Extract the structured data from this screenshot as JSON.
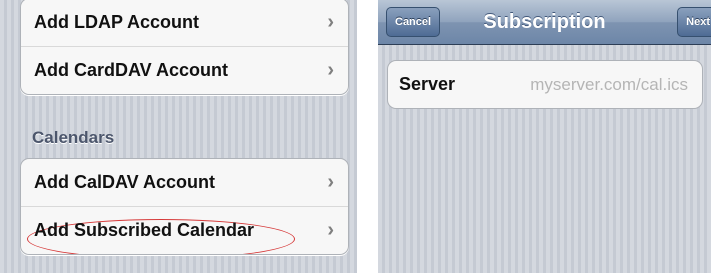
{
  "left_screen": {
    "top_group": [
      {
        "label": "Add LDAP Account"
      },
      {
        "label": "Add CardDAV Account"
      }
    ],
    "section_header": "Calendars",
    "calendar_group": [
      {
        "label": "Add CalDAV Account"
      },
      {
        "label": "Add Subscribed Calendar"
      }
    ],
    "disclosure_icon": "chevron-right-icon",
    "annotation_color": "#d63a3a"
  },
  "right_screen": {
    "navbar": {
      "cancel_label": "Cancel",
      "title": "Subscription",
      "next_label": "Next"
    },
    "server_field": {
      "label": "Server",
      "placeholder": "myserver.com/cal.ics",
      "value": ""
    }
  }
}
